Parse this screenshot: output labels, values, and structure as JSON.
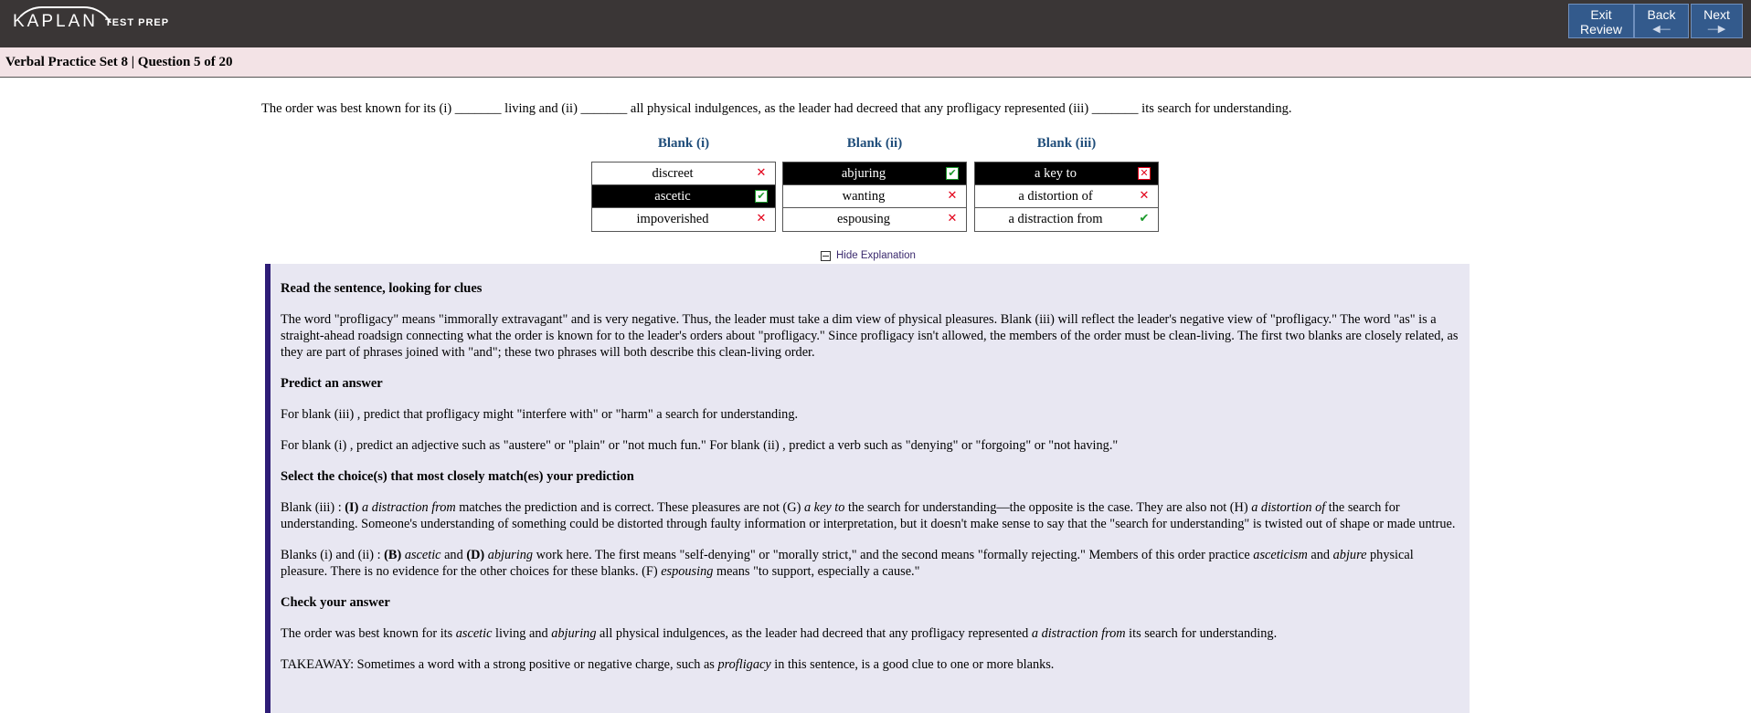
{
  "header": {
    "logo_main": "KAPLAN",
    "logo_sub": "TEST PREP",
    "buttons": {
      "exit": "Exit Review",
      "back": "Back",
      "next": "Next"
    }
  },
  "subbar": {
    "title": "Verbal Practice Set 8 | Question 5 of 20"
  },
  "question": {
    "text": "The order was best known for its (i) _______ living and (ii) _______ all physical indulgences, as the leader had decreed that any profligacy represented (iii) _______ its search for understanding."
  },
  "blanks": [
    {
      "heading": "Blank (i)",
      "choices": [
        {
          "label": "discreet",
          "selected": false,
          "mark": "x"
        },
        {
          "label": "ascetic",
          "selected": true,
          "mark": "check"
        },
        {
          "label": "impoverished",
          "selected": false,
          "mark": "x"
        }
      ]
    },
    {
      "heading": "Blank (ii)",
      "choices": [
        {
          "label": "abjuring",
          "selected": true,
          "mark": "check"
        },
        {
          "label": "wanting",
          "selected": false,
          "mark": "x"
        },
        {
          "label": "espousing",
          "selected": false,
          "mark": "x"
        }
      ]
    },
    {
      "heading": "Blank (iii)",
      "choices": [
        {
          "label": "a key to",
          "selected": true,
          "mark": "x"
        },
        {
          "label": "a distortion of",
          "selected": false,
          "mark": "x"
        },
        {
          "label": "a distraction from",
          "selected": false,
          "mark": "check"
        }
      ]
    }
  ],
  "toggle": {
    "label": "Hide Explanation"
  },
  "explanation": {
    "h1": "Read the sentence, looking for clues",
    "p1": "The word \"profligacy\" means \"immorally extravagant\" and is very negative. Thus, the leader must take a dim view of physical pleasures. Blank (iii) will reflect the leader's negative view of \"profligacy.\" The word \"as\" is a straight-ahead roadsign connecting what the order is known for to the leader's orders about \"profligacy.\" Since profligacy isn't allowed, the members of the order must be clean-living. The first two blanks are closely related, as they are part of phrases joined with \"and\"; these two phrases will both describe this clean-living order.",
    "h2": "Predict an answer",
    "p2": "For blank (iii) , predict that profligacy might \"interfere with\" or \"harm\" a search for understanding.",
    "p3": "For blank (i) , predict an adjective such as \"austere\" or \"plain\" or \"not much fun.\" For blank (ii) , predict a verb such as \"denying\" or \"forgoing\" or \"not having.\"",
    "h3": "Select the choice(s) that most closely match(es) your prediction",
    "p4": {
      "a": "Blank (iii) : ",
      "b": "(I)",
      "c": "a distraction from",
      "d": " matches the prediction and is correct. These pleasures are not (G) ",
      "e": "a key to",
      "f": " the search for understanding—the opposite is the case. They are also not (H) ",
      "g": "a distortion of",
      "h": " the search for understanding. Someone's understanding of something could be distorted through faulty information or interpretation, but it doesn't make sense to say that the \"search for understanding\" is twisted out of shape or made untrue."
    },
    "p5": {
      "a": "Blanks (i) and (ii) : ",
      "b": "(B)",
      "c": "ascetic",
      "d": " and ",
      "e": "(D)",
      "f": "abjuring",
      "g": " work here. The first means \"self-denying\" or \"morally strict,\" and the second means \"formally rejecting.\" Members of this order practice ",
      "h": "asceticism",
      "i": " and ",
      "j": "abjure",
      "k": " physical pleasure. There is no evidence for the other choices for these blanks. (F) ",
      "l": "espousing",
      "m": " means \"to support, especially a cause.\""
    },
    "h4": "Check your answer",
    "p6": {
      "a": "The order was best known for its ",
      "b": "ascetic",
      "c": " living and ",
      "d": "abjuring",
      "e": " all physical indulgences, as the leader had decreed that any profligacy represented ",
      "f": "a distraction from",
      "g": " its search for understanding."
    },
    "p7": {
      "a": "TAKEAWAY: Sometimes a word with a strong positive or negative charge, such as ",
      "b": "profligacy",
      "c": " in this sentence, is a good clue to one or more blanks."
    }
  }
}
